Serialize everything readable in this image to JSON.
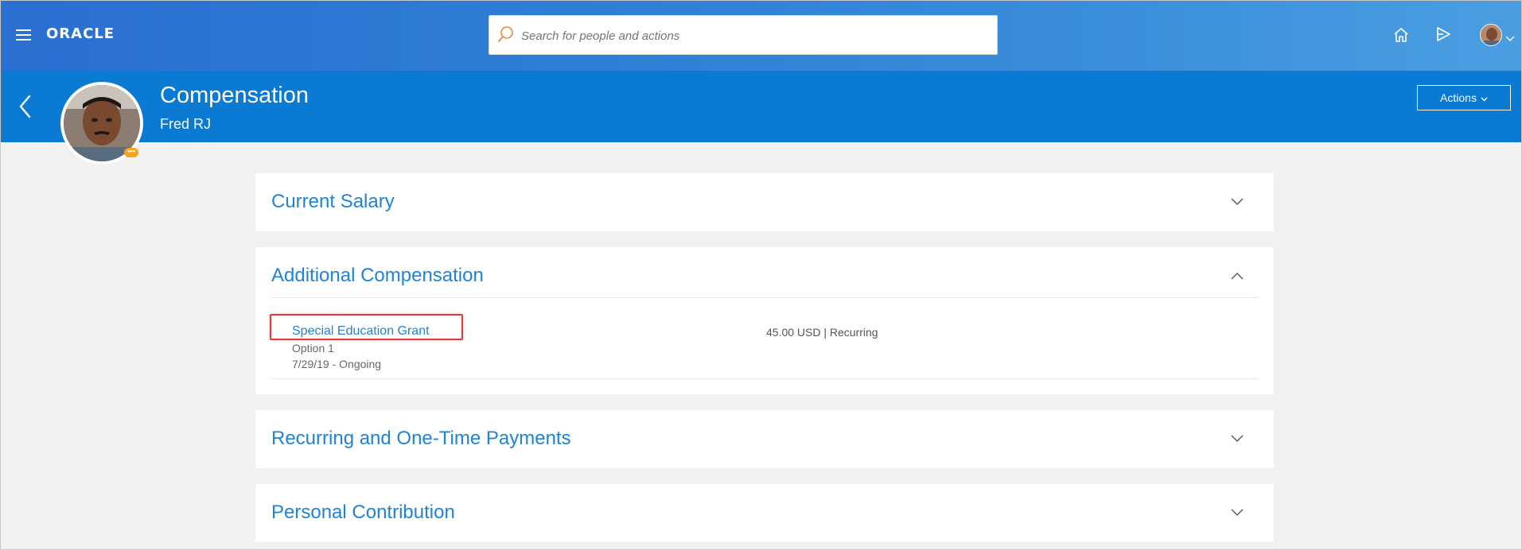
{
  "topbar": {
    "brand": "ORACLE",
    "search_placeholder": "Search for people and actions"
  },
  "header": {
    "title": "Compensation",
    "person_name": "Fred RJ",
    "actions_label": "Actions"
  },
  "sections": [
    {
      "title": "Current Salary",
      "expanded": false
    },
    {
      "title": "Additional Compensation",
      "expanded": true,
      "items": [
        {
          "name": "Special Education Grant",
          "option": "Option 1",
          "dates": "7/29/19 - Ongoing",
          "amount": "45.00 USD | Recurring"
        }
      ]
    },
    {
      "title": "Recurring and One-Time Payments",
      "expanded": false
    },
    {
      "title": "Personal Contribution",
      "expanded": false
    }
  ],
  "colors": {
    "topbar": "#2f7fd6",
    "page_header": "#0a7ad2",
    "link": "#1f84d6",
    "highlight": "#e03a3a",
    "badge": "#f6a21a",
    "background": "#f1f1f1"
  },
  "icons": [
    "menu-icon",
    "search-icon",
    "home-icon",
    "navigator-icon",
    "user-avatar",
    "chevron-down-icon",
    "back-arrow-icon",
    "chevron-up-icon"
  ]
}
